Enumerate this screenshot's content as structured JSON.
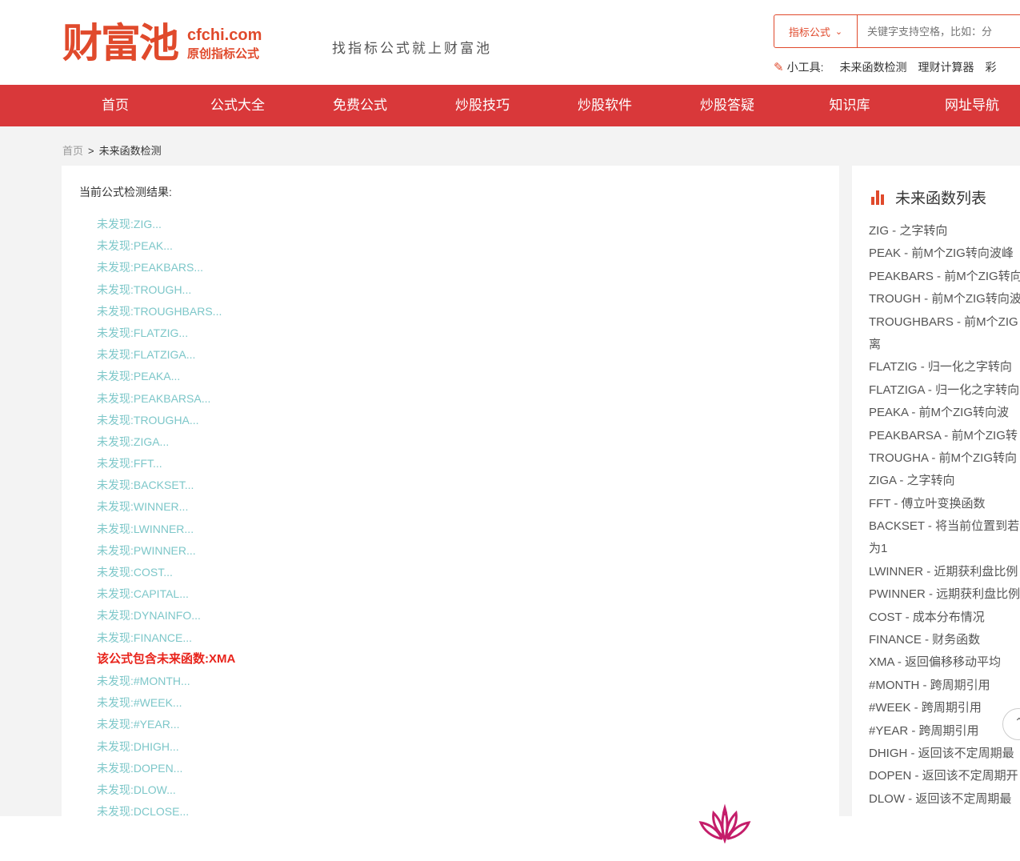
{
  "header": {
    "logo_cn": "财富池",
    "logo_domain": "cfchi.com",
    "logo_sub": "原创指标公式",
    "slogan": "找指标公式就上财富池",
    "search": {
      "category": "指标公式",
      "placeholder": "关键字支持空格，比如：分"
    },
    "tools": {
      "label": "小工具:",
      "links": [
        "未来函数检测",
        "理财计算器",
        "彩"
      ]
    }
  },
  "nav": {
    "items": [
      "首页",
      "公式大全",
      "免费公式",
      "炒股技巧",
      "炒股软件",
      "炒股答疑",
      "知识库",
      "网址导航"
    ]
  },
  "breadcrumb": {
    "home": "首页",
    "sep": ">",
    "current": "未来函数检测"
  },
  "result": {
    "title": "当前公式检测结果:",
    "items": [
      "未发现:ZIG...",
      "未发现:PEAK...",
      "未发现:PEAKBARS...",
      "未发现:TROUGH...",
      "未发现:TROUGHBARS...",
      "未发现:FLATZIG...",
      "未发现:FLATZIGA...",
      "未发现:PEAKA...",
      "未发现:PEAKBARSA...",
      "未发现:TROUGHA...",
      "未发现:ZIGA...",
      "未发现:FFT...",
      "未发现:BACKSET...",
      "未发现:WINNER...",
      "未发现:LWINNER...",
      "未发现:PWINNER...",
      "未发现:COST...",
      "未发现:CAPITAL...",
      "未发现:DYNAINFO...",
      "未发现:FINANCE...",
      "该公式包含未来函数:XMA",
      "未发现:#MONTH...",
      "未发现:#WEEK...",
      "未发现:#YEAR...",
      "未发现:DHIGH...",
      "未发现:DOPEN...",
      "未发现:DLOW...",
      "未发现:DCLOSE..."
    ],
    "found_index": 20,
    "normal_color": "#7dc7c9",
    "found_color": "#e8241c"
  },
  "sidebar": {
    "title": "未来函数列表",
    "items": [
      "ZIG - 之字转向",
      "PEAK - 前M个ZIG转向波峰",
      "PEAKBARS - 前M个ZIG转向",
      "TROUGH - 前M个ZIG转向波谷",
      "TROUGHBARS - 前M个ZIG",
      "离",
      "FLATZIG - 归一化之字转向",
      "FLATZIGA - 归一化之字转向",
      "PEAKA - 前M个ZIG转向波",
      "PEAKBARSA - 前M个ZIG转",
      "TROUGHA - 前M个ZIG转向",
      "ZIGA - 之字转向",
      "FFT - 傅立叶变换函数",
      "BACKSET - 将当前位置到若",
      "为1",
      "LWINNER - 近期获利盘比例",
      "PWINNER - 远期获利盘比例",
      "COST - 成本分布情况",
      "FINANCE - 财务函数",
      "XMA - 返回偏移移动平均",
      "#MONTH - 跨周期引用",
      "#WEEK - 跨周期引用",
      "#YEAR - 跨周期引用",
      "DHIGH - 返回该不定周期最",
      "DOPEN - 返回该不定周期开",
      "DLOW - 返回该不定周期最"
    ]
  },
  "colors": {
    "brand": "#e04a2c",
    "nav_bg": "#d9383a",
    "page_bg": "#f3f3f3"
  }
}
